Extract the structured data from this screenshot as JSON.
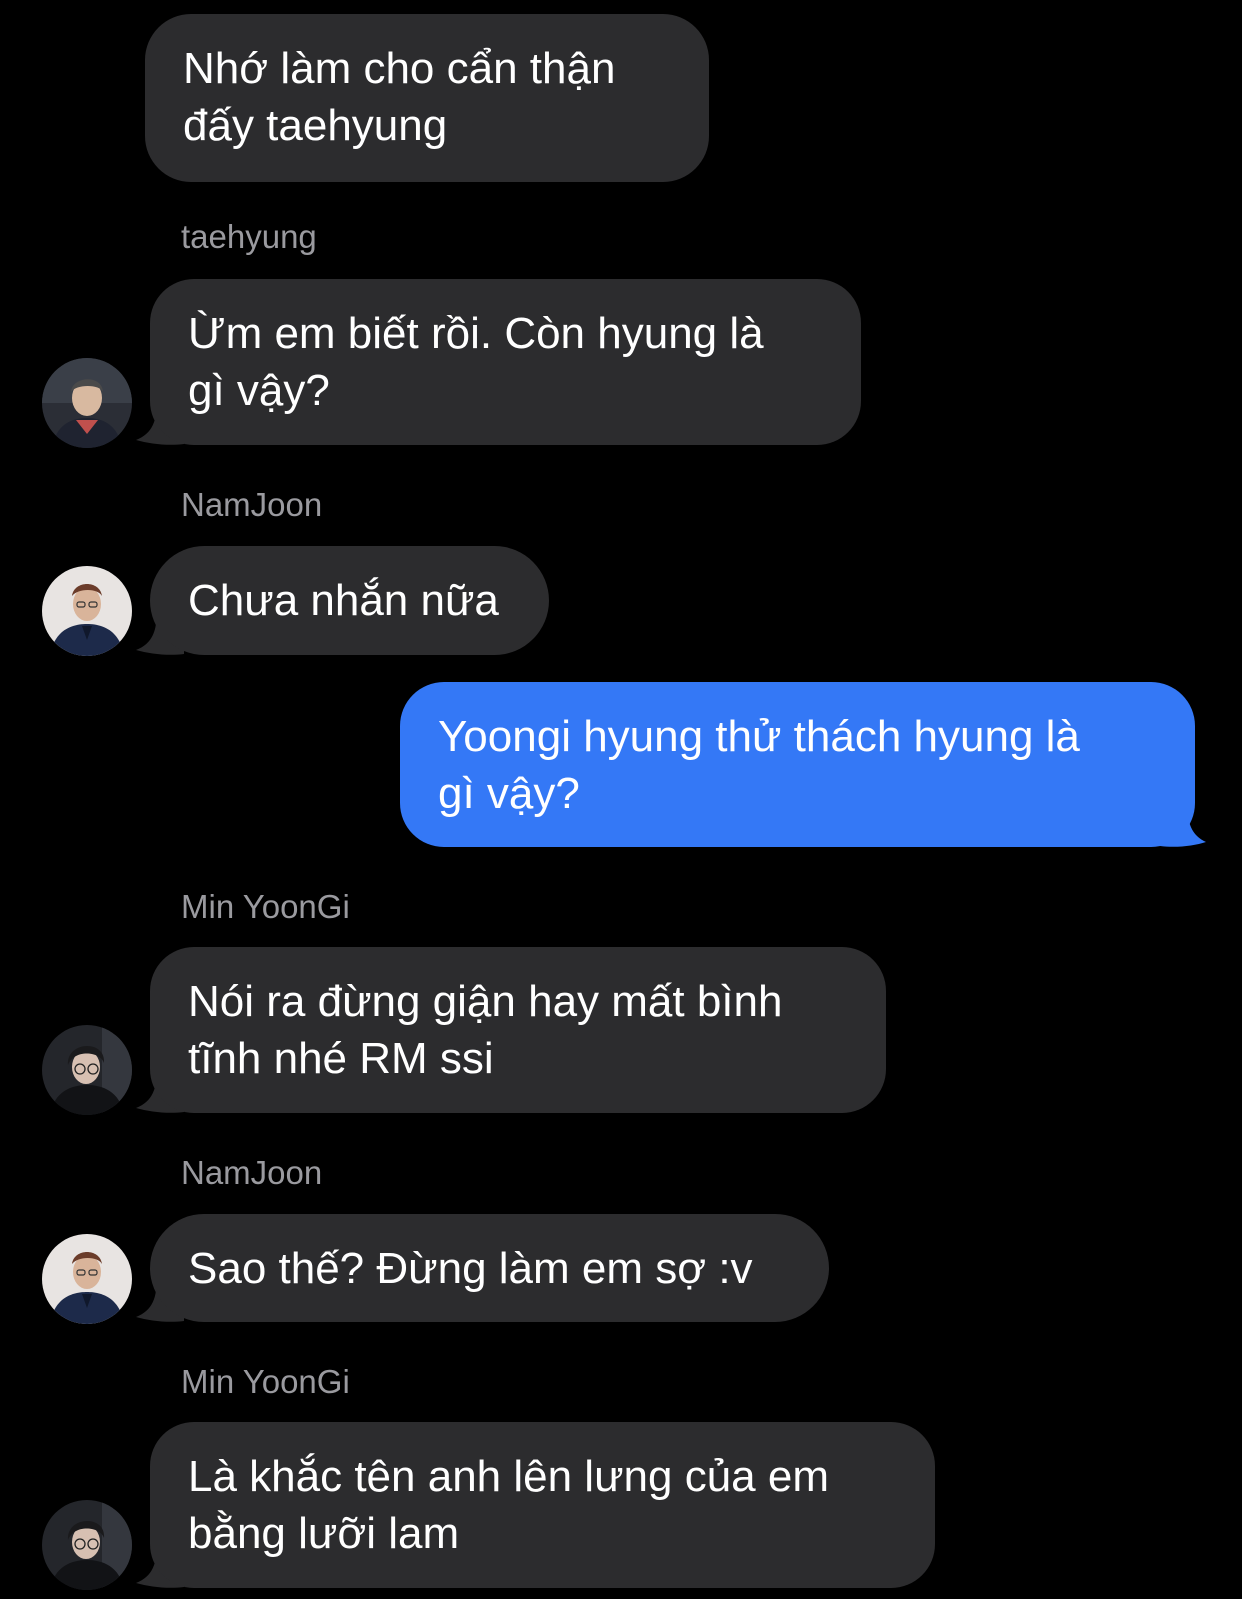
{
  "colors": {
    "background": "#000000",
    "incoming_bubble": "#2c2c2e",
    "outgoing_bubble": "#3478f6",
    "sender_name": "#9a9a9f",
    "text": "#ffffff"
  },
  "messages": [
    {
      "direction": "incoming",
      "text": "Nhớ làm cho cẩn thận\nđấy taehyung"
    },
    {
      "direction": "incoming",
      "sender": "taehyung",
      "avatar": "taehyung-avatar",
      "text": "Ừm em biết rồi. Còn hyung là\ngì vậy?"
    },
    {
      "direction": "incoming",
      "sender": "NamJoon",
      "avatar": "namjoon-avatar",
      "text": "Chưa nhắn nữa"
    },
    {
      "direction": "outgoing",
      "text": "Yoongi hyung thử thách hyung là\ngì vậy?"
    },
    {
      "direction": "incoming",
      "sender": "Min YoonGi",
      "avatar": "yoongi-avatar",
      "text": "Nói ra đừng giận hay mất bình\ntĩnh nhé RM ssi"
    },
    {
      "direction": "incoming",
      "sender": "NamJoon",
      "avatar": "namjoon-avatar",
      "text": "Sao thế? Đừng làm em sợ :v"
    },
    {
      "direction": "incoming",
      "sender": "Min YoonGi",
      "avatar": "yoongi-avatar",
      "text": "Là khắc tên anh lên lưng của em\nbằng lưỡi lam"
    }
  ]
}
